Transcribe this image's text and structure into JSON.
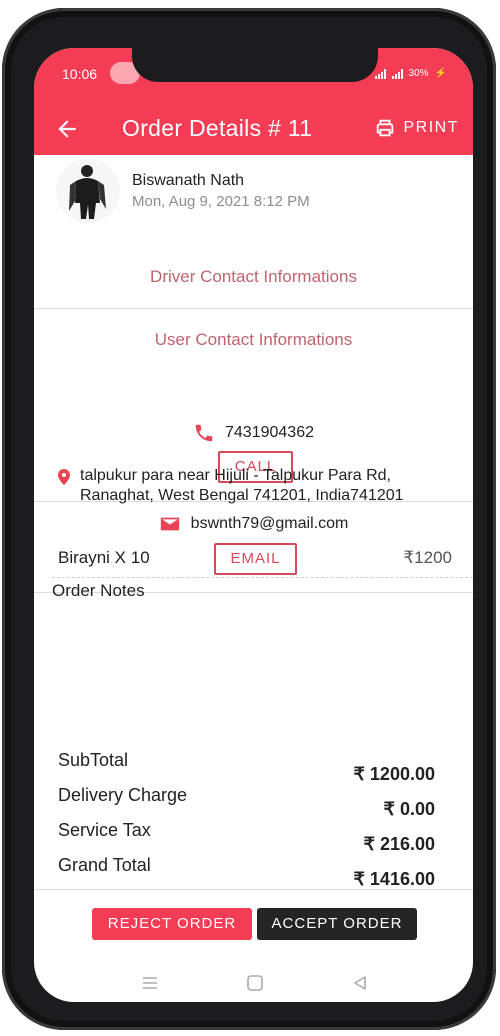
{
  "status_bar": {
    "time": "10:06",
    "battery": "30%"
  },
  "appbar": {
    "title": "Order Details # 11",
    "print_label": "PRINT"
  },
  "customer": {
    "name": "Biswanath Nath",
    "date": "Mon, Aug 9, 2021 8:12 PM"
  },
  "driver_section": {
    "title": "Driver Contact Informations"
  },
  "user_section": {
    "title": "User Contact Informations",
    "phone": "7431904362",
    "call_label": "CALL",
    "email": "bswnth79@gmail.com",
    "email_label": "EMAIL"
  },
  "address": "talpukur para near Hijuli - Talpukur Para Rd, Ranaghat, West Bengal 741201, India741201",
  "order_items": [
    {
      "name": "Birayni X 10",
      "price": "₹1200"
    }
  ],
  "order_notes_label": "Order Notes",
  "totals": [
    {
      "label": "SubTotal",
      "value": "₹ 1200.00"
    },
    {
      "label": "Delivery Charge",
      "value": "₹ 0.00"
    },
    {
      "label": "Service Tax",
      "value": "₹ 216.00"
    },
    {
      "label": "Grand Total",
      "value": "₹ 1416.00"
    }
  ],
  "actions": {
    "reject_label": "REJECT ORDER",
    "accept_label": "ACCEPT ORDER"
  },
  "colors": {
    "accent": "#f53c55",
    "accept_bg": "#252525",
    "section_title": "#c0646e"
  },
  "icons": {
    "back": "arrow-left-icon",
    "print": "printer-icon",
    "phone": "phone-icon",
    "email": "mail-icon",
    "location": "location-pin-icon",
    "nav_recents": "recents-icon",
    "nav_home": "home-icon",
    "nav_back": "nav-back-icon"
  }
}
